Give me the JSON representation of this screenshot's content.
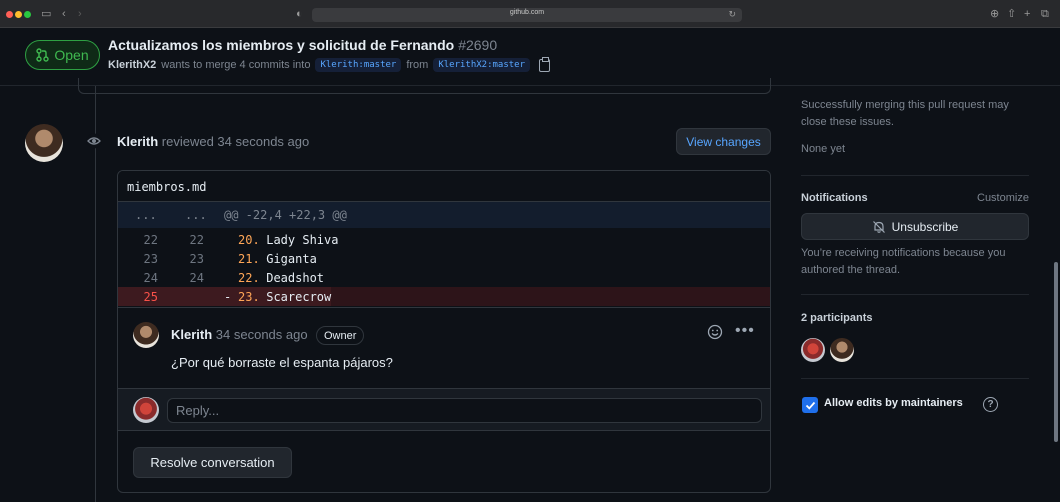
{
  "browser": {
    "url": "github.com",
    "colors": {
      "close": "#ff5f57",
      "minimize": "#febc2e",
      "zoom": "#28c840"
    }
  },
  "pr": {
    "status": "Open",
    "title": "Actualizamos los miembros y solicitud de Fernando",
    "number": "#2690",
    "author": "KlerithX2",
    "merge_text": "wants to merge 4 commits into",
    "base_branch": "Klerith:master",
    "from_text": "from",
    "head_branch": "KlerithX2:master"
  },
  "review": {
    "reviewer": "Klerith",
    "action": "reviewed 34 seconds ago",
    "view_changes_label": "View changes",
    "file_name": "miembros.md",
    "hunk_left": "...",
    "hunk_right": "...",
    "hunk_header": "@@ -22,4 +22,3 @@",
    "lines": [
      {
        "old": "22",
        "new": "22",
        "marker": "",
        "num": "20.",
        "text": " Lady Shiva",
        "type": "context"
      },
      {
        "old": "23",
        "new": "23",
        "marker": "",
        "num": "21.",
        "text": " Giganta",
        "type": "context"
      },
      {
        "old": "24",
        "new": "24",
        "marker": "",
        "num": "22.",
        "text": " Deadshot",
        "type": "context"
      },
      {
        "old": "25",
        "new": "",
        "marker": "-",
        "num": "23.",
        "text": " Scarecrow",
        "type": "deletion"
      }
    ]
  },
  "comment": {
    "author": "Klerith",
    "time": "34 seconds ago",
    "badge": "Owner",
    "body": "¿Por qué borraste el espanta pájaros?",
    "reply_placeholder": "Reply...",
    "resolve_label": "Resolve conversation"
  },
  "sidebar": {
    "linked_issues_text": "Successfully merging this pull request may close these issues.",
    "linked_issues_value": "None yet",
    "notifications_heading": "Notifications",
    "customize_label": "Customize",
    "unsubscribe_label": "Unsubscribe",
    "notifications_reason": "You’re receiving notifications because you authored the thread.",
    "participants_heading": "2 participants",
    "allow_edits_label": "Allow edits by maintainers",
    "allow_edits_checked": true,
    "help_label": "?"
  }
}
